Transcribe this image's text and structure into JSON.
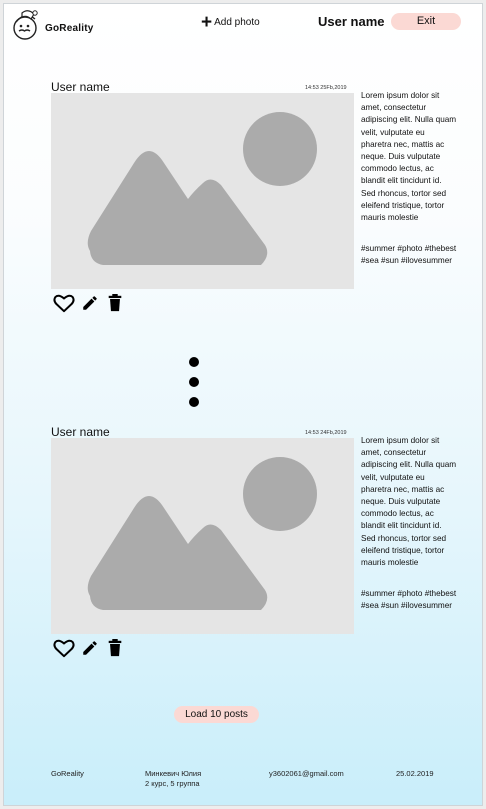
{
  "header": {
    "logo_text": "GoReality",
    "add_photo_label": "Add photo",
    "user_name": "User name",
    "exit_label": "Exit"
  },
  "posts": [
    {
      "user_name": "User name",
      "date": "14:53 25Fb,2019",
      "text": "Lorem ipsum dolor sit amet, consectetur adipiscing elit. Nulla quam velit, vulputate eu pharetra nec, mattis ac neque. Duis vulputate commodo lectus, ac blandit elit tincidunt id. Sed rhoncus, tortor sed eleifend tristique, tortor mauris molestie",
      "tags": "#summer #photo #thebest #sea #sun #ilovesummer"
    },
    {
      "user_name": "User name",
      "date": "14:53 24Fb,2019",
      "text": "Lorem ipsum dolor sit amet, consectetur adipiscing elit. Nulla quam velit, vulputate eu pharetra nec, mattis ac neque. Duis vulputate commodo lectus, ac blandit elit tincidunt id. Sed rhoncus, tortor sed eleifend tristique, tortor mauris molestie",
      "tags": "#summer #photo #thebest #sea #sun #ilovesummer"
    }
  ],
  "icons": {
    "like": "heart-icon",
    "edit": "pencil-icon",
    "delete": "trash-icon",
    "more": "more-vertical-icon",
    "placeholder": "image-placeholder-icon"
  },
  "load_more_label": "Load 10 posts",
  "footer": {
    "brand": "GoReality",
    "author_line1": "Минкевич Юлия",
    "author_line2": "2 курс, 5 группа",
    "email": "y3602061@gmail.com",
    "date": "25.02.2019"
  },
  "colors": {
    "button_bg": "#fbd9d4",
    "placeholder_bg": "#e5e5e5",
    "placeholder_shape": "#ababab"
  }
}
